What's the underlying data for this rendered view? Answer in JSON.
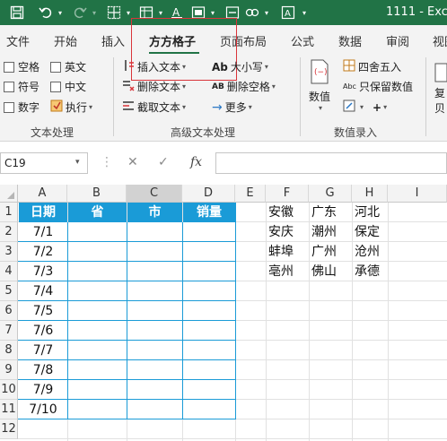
{
  "title": "1111  -  Exc",
  "tabs": [
    "文件",
    "开始",
    "插入",
    "方方格子",
    "页面布局",
    "公式",
    "数据",
    "审阅",
    "视图"
  ],
  "ribbon": {
    "text_group": {
      "label": "文本处理",
      "checkboxes": [
        "空格",
        "英文",
        "符号",
        "中文",
        "数字"
      ],
      "execute": "执行"
    },
    "advanced_group": {
      "label": "高级文本处理",
      "insert_text": "插入文本",
      "delete_text": "删除文本",
      "cut_text": "截取文本",
      "case": "大小写",
      "delete_space": "删除空格",
      "more": "更多"
    },
    "numeric_group": {
      "label": "数值录入",
      "numeric": "数值",
      "round": "四舍五入",
      "keep_value": "只保留数值",
      "copy_label": "复",
      "paste_label": "贝"
    }
  },
  "formula_bar": {
    "name_box": "C19",
    "cancel": "✕",
    "confirm": "✓",
    "fx": "fx",
    "value": ""
  },
  "sheet": {
    "columns": [
      "A",
      "B",
      "C",
      "D",
      "E",
      "F",
      "G",
      "H",
      "I"
    ],
    "rows": [
      "1",
      "2",
      "3",
      "4",
      "5",
      "6",
      "7",
      "8",
      "9",
      "10",
      "11",
      "12"
    ],
    "header_row": [
      "日期",
      "省",
      "市",
      "销量"
    ],
    "dates": [
      "7/1",
      "7/2",
      "7/3",
      "7/4",
      "7/5",
      "7/6",
      "7/7",
      "7/8",
      "7/9",
      "7/10"
    ],
    "cities": [
      [
        "安徽",
        "广东",
        "河北"
      ],
      [
        "安庆",
        "潮州",
        "保定"
      ],
      [
        "蚌埠",
        "广州",
        "沧州"
      ],
      [
        "亳州",
        "佛山",
        "承德"
      ]
    ]
  },
  "colors": {
    "excel_green": "#217346",
    "table_header_blue": "#1a9bd7",
    "highlight_red": "#d9343a"
  }
}
